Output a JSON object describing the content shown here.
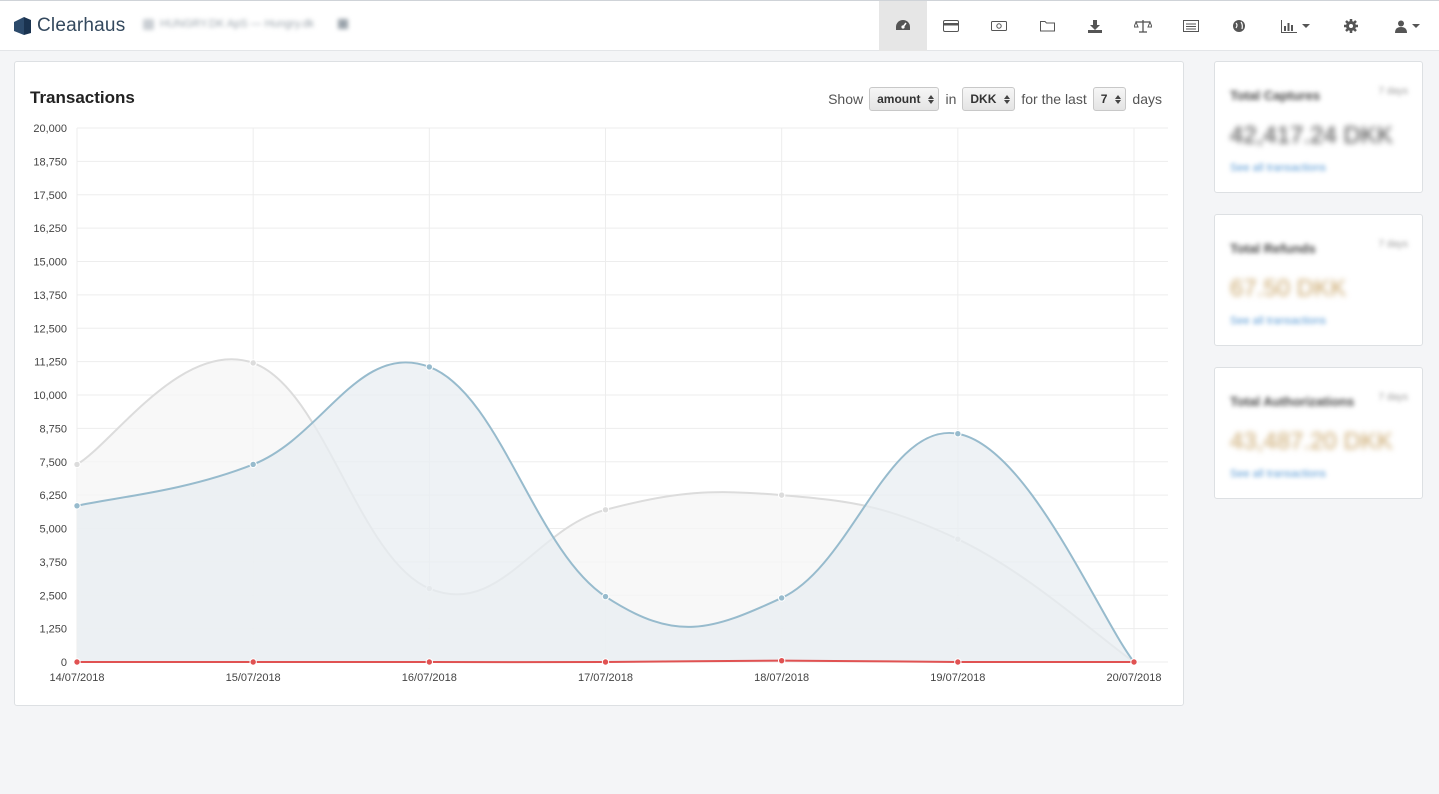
{
  "brand": {
    "name": "Clearhaus"
  },
  "merchant": {
    "label": "HUNGRY.DK ApS — Hungry.dk"
  },
  "nav": {
    "items": [
      {
        "name": "dashboard-icon",
        "active": true
      },
      {
        "name": "credit-card-icon"
      },
      {
        "name": "money-icon"
      },
      {
        "name": "folder-icon"
      },
      {
        "name": "download-icon"
      },
      {
        "name": "balance-scale-icon"
      },
      {
        "name": "list-icon"
      },
      {
        "name": "globe-icon"
      },
      {
        "name": "bar-chart-icon",
        "dropdown": true
      },
      {
        "name": "gear-icon"
      },
      {
        "name": "user-icon",
        "dropdown": true
      }
    ]
  },
  "panel": {
    "title": "Transactions",
    "controls": {
      "show_label": "Show",
      "metric_value": "amount",
      "in_label": "in",
      "currency_value": "DKK",
      "last_label": "for the last",
      "days_value": "7",
      "days_label": "days"
    }
  },
  "chart_data": {
    "type": "area",
    "categories": [
      "14/07/2018",
      "15/07/2018",
      "16/07/2018",
      "17/07/2018",
      "18/07/2018",
      "19/07/2018",
      "20/07/2018"
    ],
    "yticks": [
      "0",
      "1,250",
      "2,500",
      "3,750",
      "5,000",
      "6,250",
      "7,500",
      "8,750",
      "10,000",
      "11,250",
      "12,500",
      "13,750",
      "15,000",
      "16,250",
      "17,500",
      "18,750",
      "20,000"
    ],
    "ylim": [
      0,
      20000
    ],
    "grid": true,
    "series": [
      {
        "values": [
          7400,
          11200,
          2750,
          5700,
          6250,
          4600,
          0
        ],
        "color": "#dcdcdc",
        "fill": "#f5f5f5"
      },
      {
        "values": [
          5850,
          7400,
          11050,
          2450,
          2400,
          8550,
          0
        ],
        "color": "#97bbcd",
        "fill": "#e8eef2"
      },
      {
        "values": [
          0,
          0,
          0,
          0,
          50,
          0,
          0
        ],
        "color": "#e05252",
        "fill": "none"
      }
    ]
  },
  "stats": [
    {
      "label": "Total Captures",
      "days": "7 days",
      "value": "42,417.24 DKK",
      "value_color": "#444444",
      "link": "See all transactions"
    },
    {
      "label": "Total Refunds",
      "days": "7 days",
      "value": "67.50 DKK",
      "value_color": "#c9a66b",
      "link": "See all transactions"
    },
    {
      "label": "Total Authorizations",
      "days": "7 days",
      "value": "43,487.20 DKK",
      "value_color": "#c9a66b",
      "link": "See all transactions"
    }
  ]
}
